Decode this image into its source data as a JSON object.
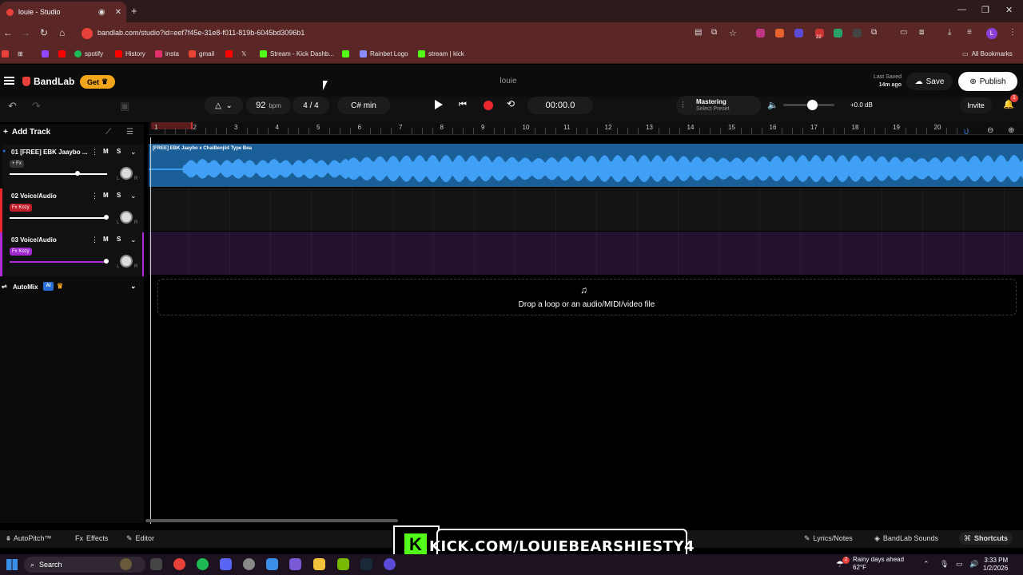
{
  "browser": {
    "tab_title": "louie - Studio",
    "url": "bandlab.com/studio?id=eef7f45e-31e8-f011-819b-6045bd3096b1",
    "bookmarks": [
      {
        "label": "spotify",
        "color": "#1db954"
      },
      {
        "label": "History",
        "color": "#ff0000"
      },
      {
        "label": "insta",
        "color": "#e1306c"
      },
      {
        "label": "gmail",
        "color": "#ea4335"
      },
      {
        "label": "Stream - Kick Dashb...",
        "color": "#53fc18"
      },
      {
        "label": "Rainbet Logo",
        "color": "#8a8aff"
      },
      {
        "label": "stream | kick",
        "color": "#53fc18"
      }
    ],
    "all_bookmarks": "All Bookmarks",
    "ext_badge": "22"
  },
  "app": {
    "logo": "BandLab",
    "get_label": "Get",
    "project_name": "louie",
    "last_saved_label": "Last Saved",
    "last_saved_value": "14m ago",
    "save_label": "Save",
    "publish_label": "Publish",
    "invite_label": "Invite",
    "notif_count": "1"
  },
  "toolbar": {
    "bpm": "92",
    "bpm_unit": "bpm",
    "time_sig": "4 / 4",
    "key": "C# min",
    "timecode": "00:00.0",
    "mastering_title": "Mastering",
    "mastering_sub": "Select Preset",
    "volume_db": "+0.0 dB",
    "volume_level": 0.56
  },
  "tracks_panel": {
    "add_track": "Add Track",
    "tracks": [
      {
        "name": "01 [FREE] EBK Jaaybo ...",
        "fx": "+ Fx",
        "mute": "M",
        "solo": "S",
        "volume": 0.7,
        "accent": "#2a6fd6"
      },
      {
        "name": "02 Voice/Audio",
        "fx": "Fx Kozy",
        "mute": "M",
        "solo": "S",
        "volume": 0.99,
        "accent": "#e8282d"
      },
      {
        "name": "03 Voice/Audio",
        "fx": "Fx Kozy",
        "mute": "M",
        "solo": "S",
        "volume": 0.99,
        "accent": "#b02ad6"
      }
    ],
    "automix": "AutoMix",
    "automix_badge": "AI"
  },
  "timeline": {
    "bars": [
      "1",
      "2",
      "3",
      "4",
      "5",
      "6",
      "7",
      "8",
      "9",
      "10",
      "11",
      "12",
      "13",
      "14",
      "15",
      "16",
      "17",
      "18",
      "19",
      "20"
    ],
    "clip_label": "[FREE] EBK Jaaybo x ChaiBenjii4 Type Bea",
    "drop_text": "Drop a loop or an audio/MIDI/video file"
  },
  "bottom": {
    "autopitch": "AutoPitch™",
    "effects": "Effects",
    "editor": "Editor",
    "lyrics": "Lyrics/Notes",
    "sounds": "BandLab Sounds",
    "shortcuts": "Shortcuts",
    "kick_banner": "KICK.COM/LOUIEBEARSHIESTY4"
  },
  "taskbar": {
    "search": "Search",
    "weather_title": "Rainy days ahead",
    "weather_temp": "62°F",
    "weather_badge": "2",
    "time": "3:33 PM",
    "date": "1/2/2026"
  }
}
